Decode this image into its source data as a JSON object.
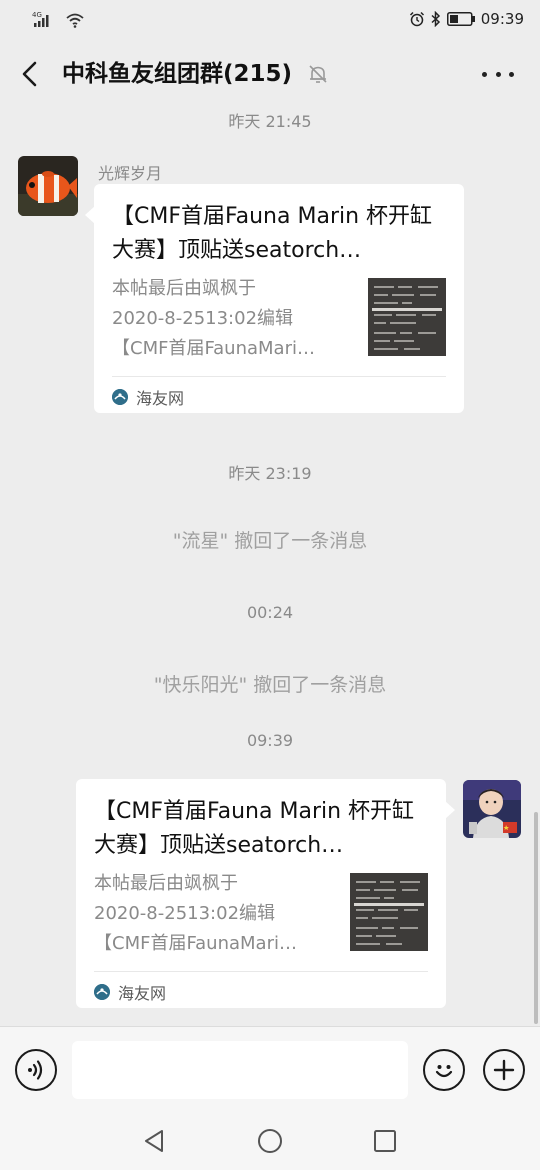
{
  "status_bar": {
    "network": "4G",
    "time": "09:39"
  },
  "header": {
    "title": "中科鱼友组团群(215)",
    "icons": [
      "back-icon",
      "mute-bell-icon",
      "more-icon"
    ]
  },
  "messages": {
    "ts1": "昨天 21:45",
    "sender1_name": "光辉岁月",
    "card1": {
      "title": "【CMF首届Fauna Marin 杯开缸大赛】顶贴送seatorch…",
      "desc_line1": "本帖最后由飒枫于",
      "desc_line2": "2020-8-2513:02编辑",
      "desc_line3": "【CMF首届FaunaMari…",
      "source": "海友网"
    },
    "ts2": "昨天 23:19",
    "sys1": "\"流星\" 撤回了一条消息",
    "ts3": "00:24",
    "sys2": "\"快乐阳光\" 撤回了一条消息",
    "ts4": "09:39",
    "card2": {
      "title": "【CMF首届Fauna Marin 杯开缸大赛】顶贴送seatorch…",
      "desc_line1": "本帖最后由飒枫于",
      "desc_line2": "2020-8-2513:02编辑",
      "desc_line3": "【CMF首届FaunaMari…",
      "source": "海友网"
    }
  },
  "input_bar": {
    "placeholder": "",
    "icons": [
      "voice-icon",
      "emoji-icon",
      "plus-icon"
    ]
  },
  "nav_bar": {
    "icons": [
      "nav-back-icon",
      "nav-home-icon",
      "nav-recent-icon"
    ]
  },
  "colors": {
    "background": "#ededed",
    "bubble": "#ffffff",
    "timestamp_text": "#8a8a8a"
  }
}
